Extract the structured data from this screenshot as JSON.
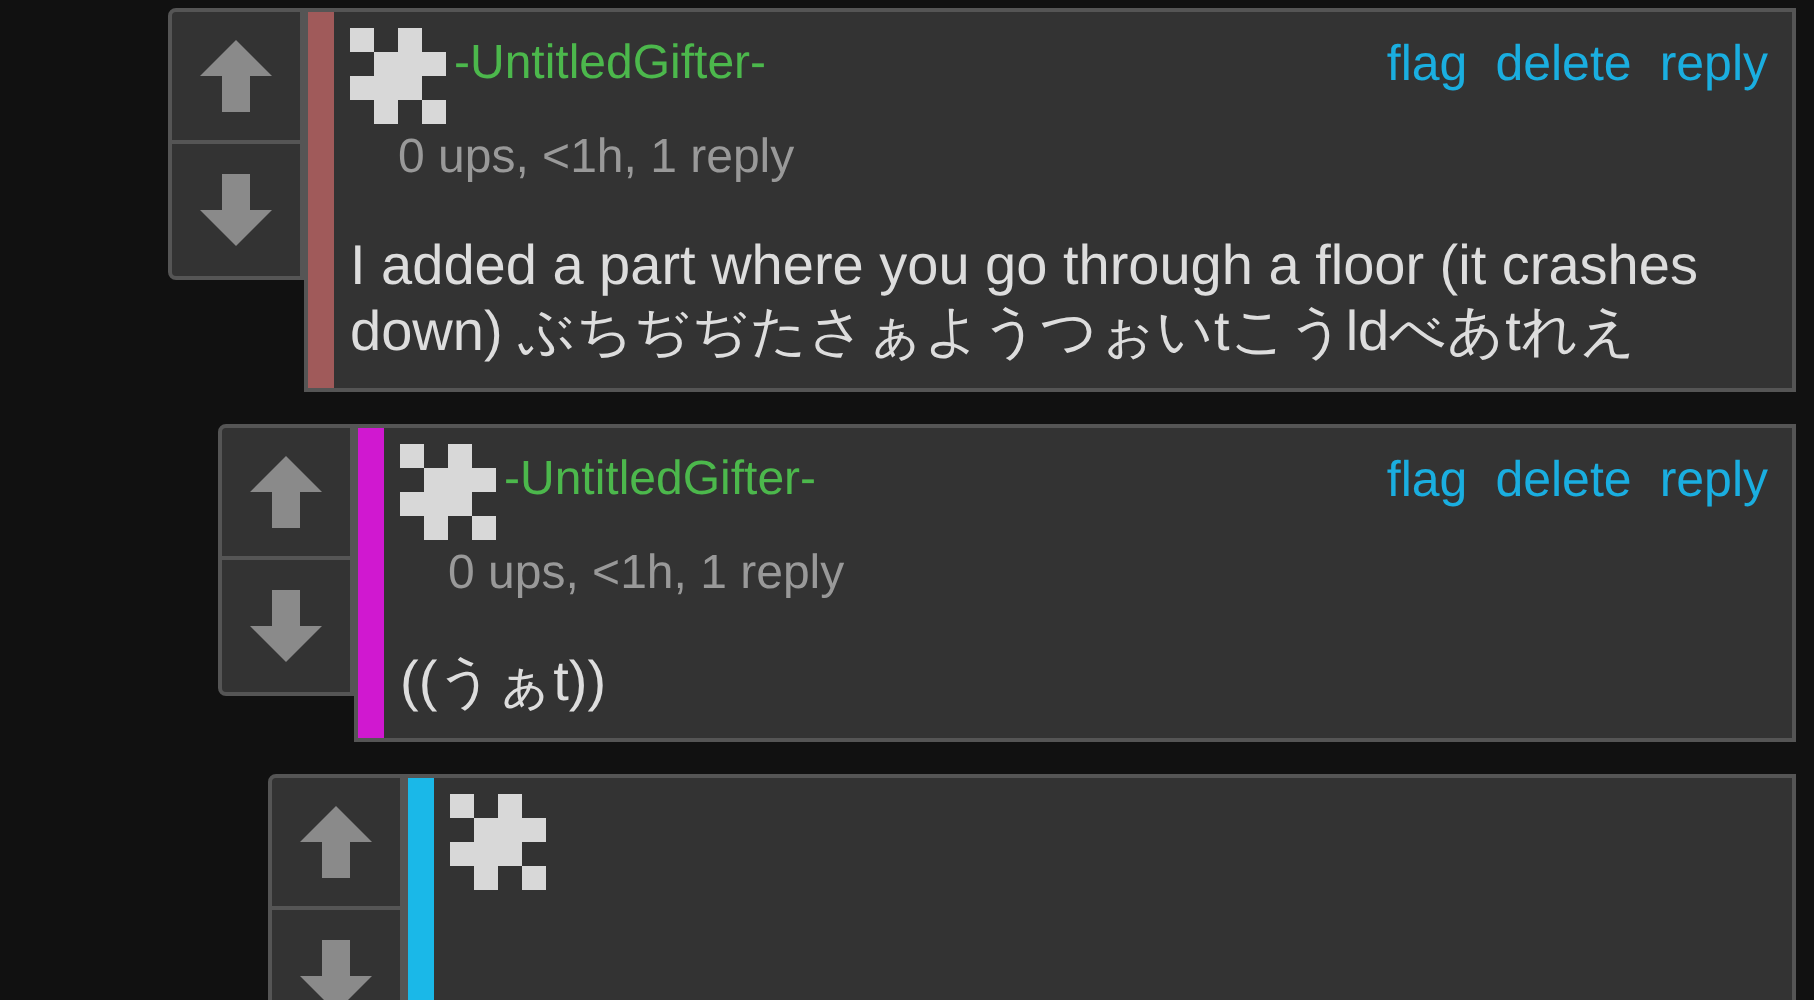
{
  "comments": [
    {
      "color": "#a05a5a",
      "author": "-UntitledGifter-",
      "meta": "0 ups, <1h, 1 reply",
      "actions": [
        "flag",
        "delete",
        "reply"
      ],
      "body": "I added a part where you go through a floor (it crashes down) ぶちぢぢたさぁようつぉいtこうldべあtれえ",
      "children": [
        {
          "color": "#d018d0",
          "author": "-UntitledGifter-",
          "meta": "0 ups, <1h, 1 reply",
          "actions": [
            "flag",
            "delete",
            "reply"
          ],
          "body": "((うぁt))",
          "children": [
            {
              "color": "#1ab8e8"
            }
          ]
        }
      ]
    }
  ]
}
